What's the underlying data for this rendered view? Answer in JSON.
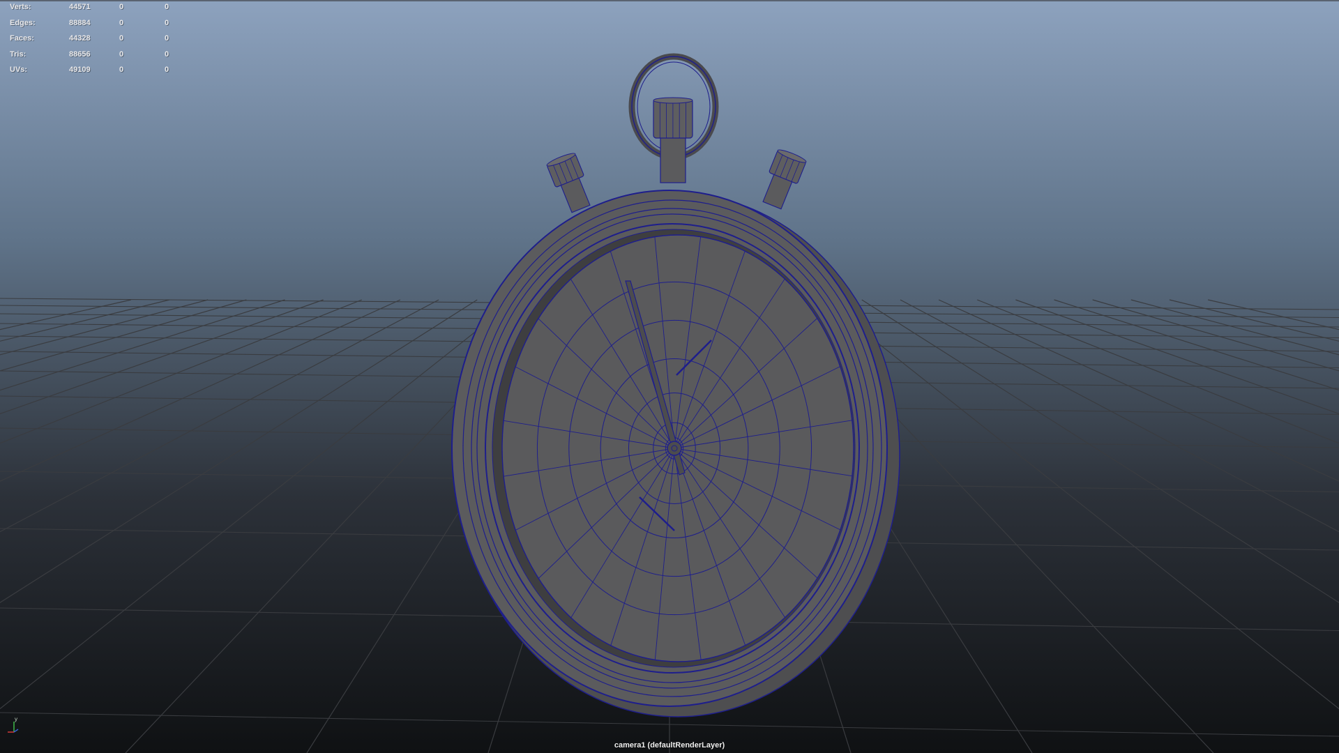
{
  "hud": {
    "rows": [
      {
        "label": "Verts:",
        "value": "44571",
        "v1": "0",
        "v2": "0"
      },
      {
        "label": "Edges:",
        "value": "88884",
        "v1": "0",
        "v2": "0"
      },
      {
        "label": "Faces:",
        "value": "44328",
        "v1": "0",
        "v2": "0"
      },
      {
        "label": "Tris:",
        "value": "88656",
        "v1": "0",
        "v2": "0"
      },
      {
        "label": "UVs:",
        "value": "49109",
        "v1": "0",
        "v2": "0"
      }
    ]
  },
  "camera_label": "camera1 (defaultRenderLayer)",
  "axis": {
    "y": "y"
  },
  "colors": {
    "sky_top": "#8da2be",
    "sky_mid": "#5f7389",
    "floor_bottom": "#0f1113",
    "grid": "#3a3c40",
    "model_fill": "#5b5b5d",
    "wire": "#1e1e8c"
  }
}
